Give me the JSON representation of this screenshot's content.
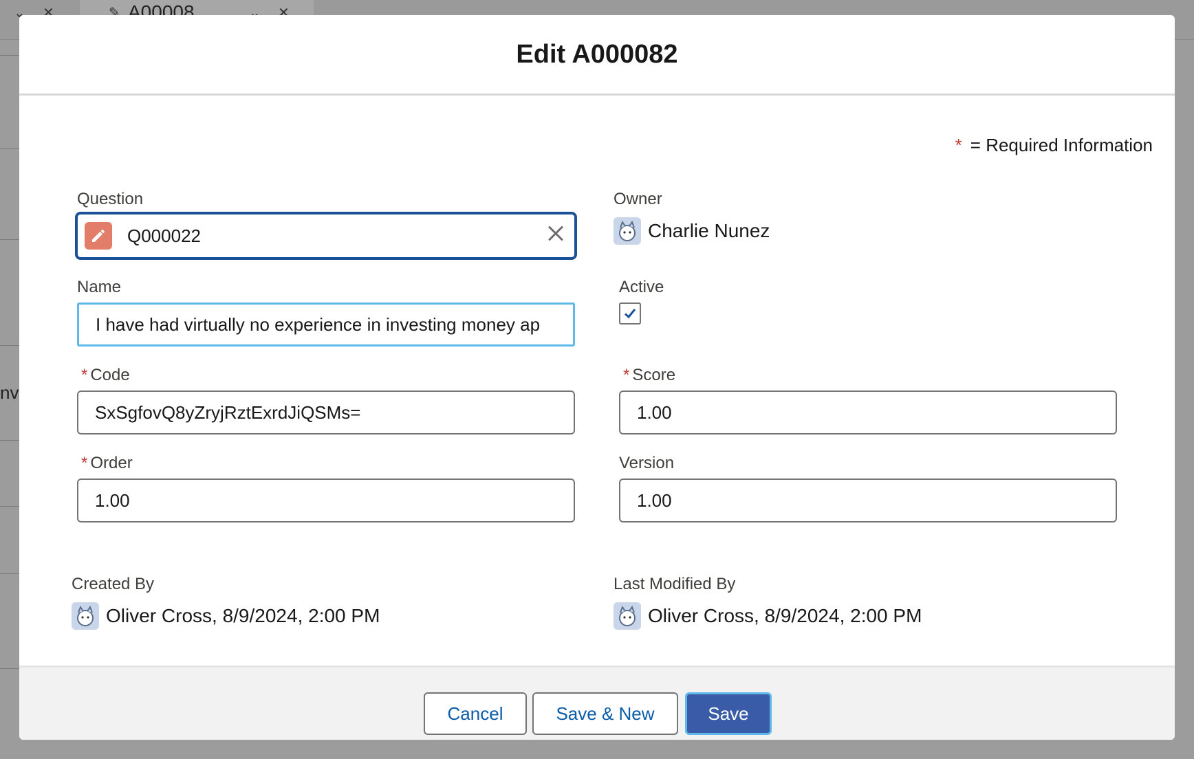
{
  "background": {
    "tab_label": "A00008",
    "side_text": "nv"
  },
  "modal": {
    "title": "Edit A000082",
    "required_note": "= Required Information",
    "required_star": "*"
  },
  "fields": {
    "question": {
      "label": "Question",
      "value": "Q000022",
      "icon": "pencil-icon"
    },
    "owner": {
      "label": "Owner",
      "value": "Charlie Nunez"
    },
    "name": {
      "label": "Name",
      "value": "I have had virtually no experience in investing money ap"
    },
    "active": {
      "label": "Active",
      "checked": true
    },
    "code": {
      "label": "Code",
      "required": "*",
      "value": "SxSgfovQ8yZryjRztExrdJiQSMs="
    },
    "score": {
      "label": "Score",
      "required": "*",
      "value": "1.00"
    },
    "order": {
      "label": "Order",
      "required": "*",
      "value": "1.00"
    },
    "version": {
      "label": "Version",
      "value": "1.00"
    }
  },
  "system_info": {
    "created_by": {
      "label": "Created By",
      "value": "Oliver Cross, 8/9/2024, 2:00 PM"
    },
    "last_modified_by": {
      "label": "Last Modified By",
      "value": "Oliver Cross, 8/9/2024, 2:00 PM"
    }
  },
  "footer": {
    "cancel": "Cancel",
    "save_new": "Save & New",
    "save": "Save"
  },
  "colors": {
    "brand": "#3a5ba7",
    "focus": "#5fb8ea",
    "required": "#c23934",
    "lookup_icon_bg": "#e27d6a"
  }
}
